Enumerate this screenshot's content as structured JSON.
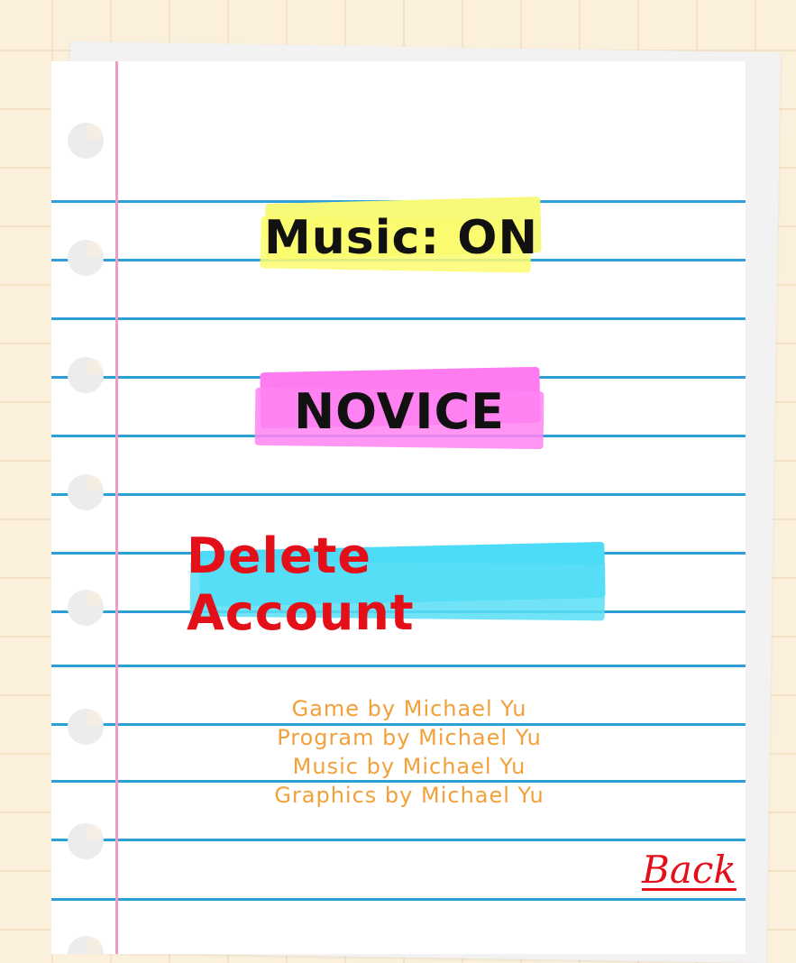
{
  "settings": {
    "music_label": "Music: ON",
    "difficulty_label": "NOVICE",
    "delete_account_label": "Delete Account"
  },
  "credits": [
    "Game by Michael Yu",
    "Program by Michael Yu",
    "Music by Michael Yu",
    "Graphics by Michael Yu"
  ],
  "navigation": {
    "back_label": "Back"
  },
  "colors": {
    "background": "#fbf0dc",
    "rule_line": "#2e9fd6",
    "margin_line": "#ec9cc2",
    "music_highlight": "#f6f97a",
    "difficulty_highlight": "#ff7cf0",
    "delete_highlight": "#4ddcf7",
    "delete_text": "#e3101a",
    "credits_text": "#f2a13a",
    "back_text": "#e3101a"
  }
}
